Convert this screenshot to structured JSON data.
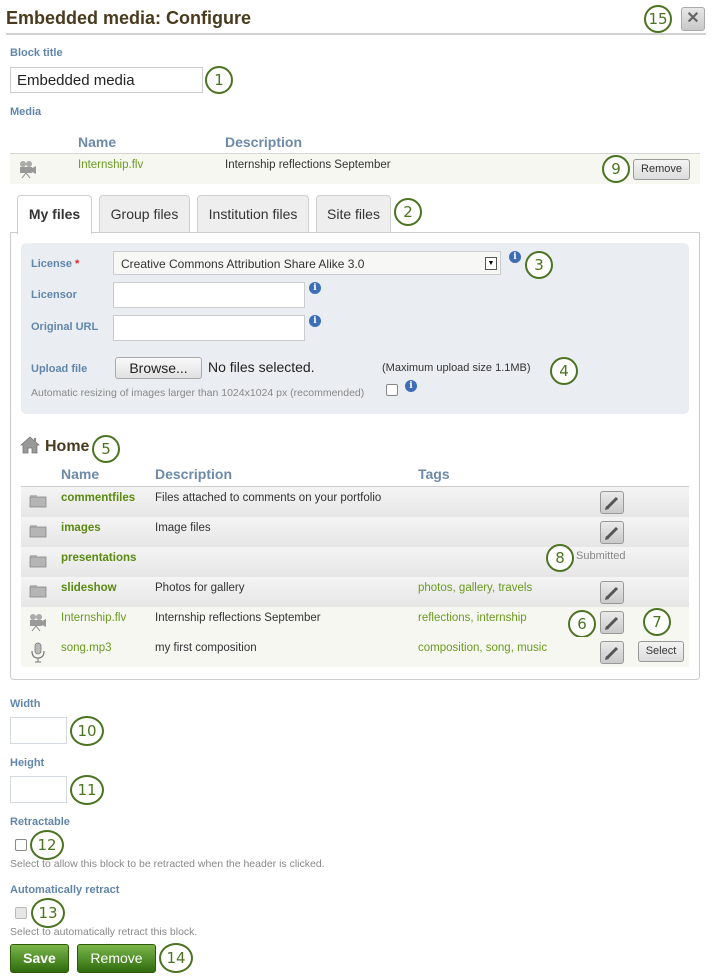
{
  "header": {
    "title": "Embedded media: Configure",
    "close_icon": "close-x-icon"
  },
  "block_title": {
    "label": "Block title",
    "value": "Embedded media"
  },
  "media": {
    "label": "Media",
    "columns": [
      "Name",
      "Description"
    ],
    "selected": {
      "icon": "video-camera-icon",
      "name": "Internship.flv",
      "description": "Internship reflections September",
      "remove_label": "Remove"
    }
  },
  "tabs": [
    {
      "label": "My files",
      "active": true
    },
    {
      "label": "Group files",
      "active": false
    },
    {
      "label": "Institution files",
      "active": false
    },
    {
      "label": "Site files",
      "active": false
    }
  ],
  "upload": {
    "license_label": "License",
    "license_required_marker": "*",
    "license_value": "Creative Commons Attribution Share Alike 3.0",
    "licensor_label": "Licensor",
    "licensor_value": "",
    "original_url_label": "Original URL",
    "original_url_value": "",
    "upload_file_label": "Upload file",
    "browse_label": "Browse...",
    "no_files_text": "No files selected.",
    "max_size_text": "(Maximum upload size 1.1MB)",
    "resize_text": "Automatic resizing of images larger than 1024x1024 px (recommended)",
    "resize_checked": false,
    "info_icon": "i"
  },
  "files": {
    "folder_title": "Home",
    "columns": [
      "Name",
      "Description",
      "Tags"
    ],
    "rows": [
      {
        "type": "folder",
        "icon": "folder-icon",
        "name": "commentfiles",
        "description": "Files attached to comments on your portfolio",
        "tags": [],
        "status": "",
        "action": ""
      },
      {
        "type": "folder",
        "icon": "folder-icon",
        "name": "images",
        "description": "Image files",
        "tags": [],
        "status": "",
        "action": ""
      },
      {
        "type": "folder",
        "icon": "folder-icon",
        "name": "presentations",
        "description": "",
        "tags": [],
        "status": "Submitted",
        "action": ""
      },
      {
        "type": "folder",
        "icon": "folder-icon",
        "name": "slideshow",
        "description": "Photos for gallery",
        "tags": [
          "photos",
          "gallery",
          "travels"
        ],
        "status": "",
        "action": ""
      },
      {
        "type": "file",
        "icon": "video-camera-icon",
        "name": "Internship.flv",
        "description": "Internship reflections September",
        "tags": [
          "reflections",
          "internship"
        ],
        "status": "",
        "action": ""
      },
      {
        "type": "file",
        "icon": "microphone-icon",
        "name": "song.mp3",
        "description": "my first composition",
        "tags": [
          "composition",
          "song",
          "music"
        ],
        "status": "",
        "action": "Select"
      }
    ],
    "tags_joined": [
      "",
      "",
      "",
      "photos, gallery, travels",
      "reflections, internship",
      "composition, song, music"
    ]
  },
  "dimensions": {
    "width_label": "Width",
    "width_value": "",
    "height_label": "Height",
    "height_value": ""
  },
  "retractable": {
    "label": "Retractable",
    "checked": false,
    "hint": "Select to allow this block to be retracted when the header is clicked."
  },
  "auto_retract": {
    "label": "Automatically retract",
    "checked": false,
    "disabled": true,
    "hint": "Select to automatically retract this block."
  },
  "footer": {
    "save_label": "Save",
    "remove_label": "Remove"
  },
  "callouts": [
    "1",
    "2",
    "3",
    "4",
    "5",
    "6",
    "7",
    "8",
    "9",
    "10",
    "11",
    "12",
    "13",
    "14",
    "15"
  ],
  "colors": {
    "accent_green": "#4b7321",
    "link_green": "#6a9a1f",
    "label_blue": "#6186ac",
    "title_brown": "#4a3a1e",
    "info_blue": "#3d6db5"
  }
}
